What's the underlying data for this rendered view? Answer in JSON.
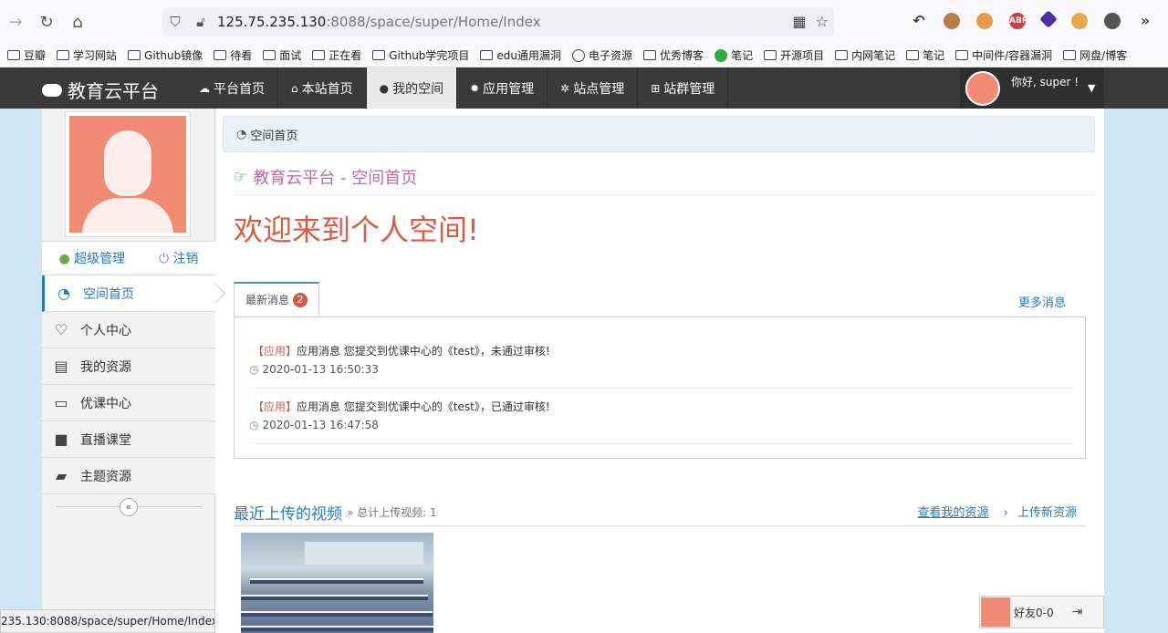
{
  "browser": {
    "url_host": "125.75.235.130",
    "url_rest": ":8088/space/super/Home/Index",
    "bookmarks": [
      "豆瓣",
      "学习网站",
      "Github镜像",
      "待看",
      "面试",
      "正在看",
      "Github学完项目",
      "edu通用漏洞",
      "电子资源",
      "优秀博客",
      "笔记",
      "开源项目",
      "内网笔记",
      "笔记",
      "中间件/容器漏洞",
      "网盘/博客"
    ],
    "status_url": "235.130:8088/space/super/Home/Index#"
  },
  "nav": {
    "brand": "教育云平台",
    "items": [
      {
        "label": "平台首页",
        "icon": "cloud-icon"
      },
      {
        "label": "本站首页",
        "icon": "home-icon"
      },
      {
        "label": "我的空间",
        "icon": "user-icon"
      },
      {
        "label": "应用管理",
        "icon": "gear-icon"
      },
      {
        "label": "站点管理",
        "icon": "gears-icon"
      },
      {
        "label": "站群管理",
        "icon": "sitemap-icon"
      }
    ],
    "greeting": "你好, super !"
  },
  "sidebar": {
    "admin_label": "超级管理",
    "logout_label": "注销",
    "items": [
      {
        "label": "空间首页",
        "icon": "dashboard-icon"
      },
      {
        "label": "个人中心",
        "icon": "heart-icon"
      },
      {
        "label": "我的资源",
        "icon": "film-icon"
      },
      {
        "label": "优课中心",
        "icon": "laptop-icon"
      },
      {
        "label": "直播课堂",
        "icon": "video-camera-icon"
      },
      {
        "label": "主题资源",
        "icon": "book-icon"
      }
    ],
    "collapse_glyph": "«"
  },
  "main": {
    "breadcrumb": "空间首页",
    "header": "教育云平台 - 空间首页",
    "welcome": "欢迎来到个人空间!",
    "tab_label": "最新消息",
    "tab_badge": "2",
    "more_label": "更多消息",
    "messages": [
      {
        "tag": "【应用】",
        "text": "应用消息  您提交到优课中心的《test》，未通过审核!",
        "time": "2020-01-13 16:50:33"
      },
      {
        "tag": "【应用】",
        "text": "应用消息  您提交到优课中心的《test》，已通过审核!",
        "time": "2020-01-13 16:47:58"
      }
    ],
    "recent_title": "最近上传的视频",
    "recent_sub": "» 总计上传视频:  1",
    "link_my_resources": "查看我的资源",
    "link_upload": "上传新资源"
  },
  "friends": {
    "label": "好友0-0"
  },
  "colors": {
    "accent": "#2a7ab8",
    "welcome": "#dd5a43",
    "header": "#c06aa6",
    "badge": "#d15b47"
  }
}
